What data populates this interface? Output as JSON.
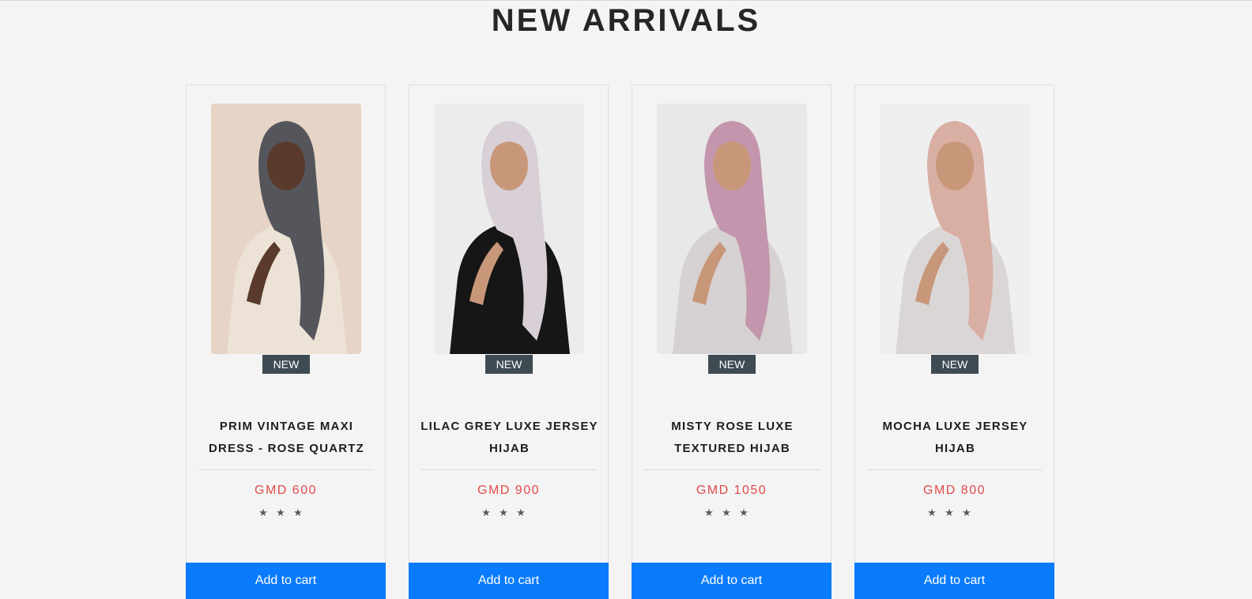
{
  "section": {
    "title": "NEW ARRIVALS"
  },
  "products": [
    {
      "name": "PRIM VINTAGE MAXI DRESS - ROSE QUARTZ",
      "badge": "NEW",
      "price": "GMD 600",
      "rating_stars": 3,
      "cart_label": "Add to cart",
      "photo_colors": {
        "background": "#e6d4c6",
        "scarf": "#55565c",
        "garment": "#ece2d6",
        "skin": "#5a3a2c"
      }
    },
    {
      "name": "LILAC GREY LUXE JERSEY HIJAB",
      "badge": "NEW",
      "price": "GMD 900",
      "rating_stars": 3,
      "cart_label": "Add to cart",
      "photo_colors": {
        "background": "#ececec",
        "scarf": "#d8d0d6",
        "garment": "#161616",
        "skin": "#c8977a"
      }
    },
    {
      "name": "MISTY ROSE LUXE TEXTURED HIJAB",
      "badge": "NEW",
      "price": "GMD 1050",
      "rating_stars": 3,
      "cart_label": "Add to cart",
      "photo_colors": {
        "background": "#e8e8e8",
        "scarf": "#c396ad",
        "garment": "#d6d1d2",
        "skin": "#c8977a"
      }
    },
    {
      "name": "MOCHA LUXE JERSEY HIJAB",
      "badge": "NEW",
      "price": "GMD 800",
      "rating_stars": 3,
      "cart_label": "Add to cart",
      "photo_colors": {
        "background": "#efefef",
        "scarf": "#d9aea3",
        "garment": "#dad6d6",
        "skin": "#c8977a"
      }
    }
  ],
  "colors": {
    "page_background": "#f4f4f4",
    "price": "#e24b4b",
    "badge": "#3f4b52",
    "cart_button": "#0a7bfc",
    "star": "#555c60"
  }
}
